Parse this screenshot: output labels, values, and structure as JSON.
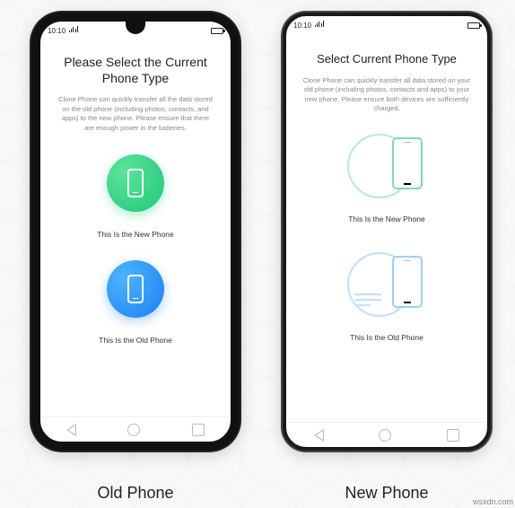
{
  "statusbar": {
    "time": "10:10"
  },
  "old_phone": {
    "title": "Please Select the Current Phone Type",
    "description": "Clone Phone can quickly transfer all the data stored on the old phone (including photos, contacts, and apps) to the new phone. Please ensure that there are enough power in the batteries.",
    "option_new_label": "This Is the New Phone",
    "option_old_label": "This Is the Old Phone",
    "caption": "Old Phone"
  },
  "new_phone": {
    "title": "Select Current Phone Type",
    "description": "Clone Phone can quickly transfer all data stored on your old phone (including photos, contacts and apps) to your new phone. Please ensure both devices are sufficiently charged.",
    "option_new_label": "This Is the New Phone",
    "option_old_label": "This Is the Old Phone",
    "caption": "New Phone"
  },
  "watermark": "wsxdn.com"
}
